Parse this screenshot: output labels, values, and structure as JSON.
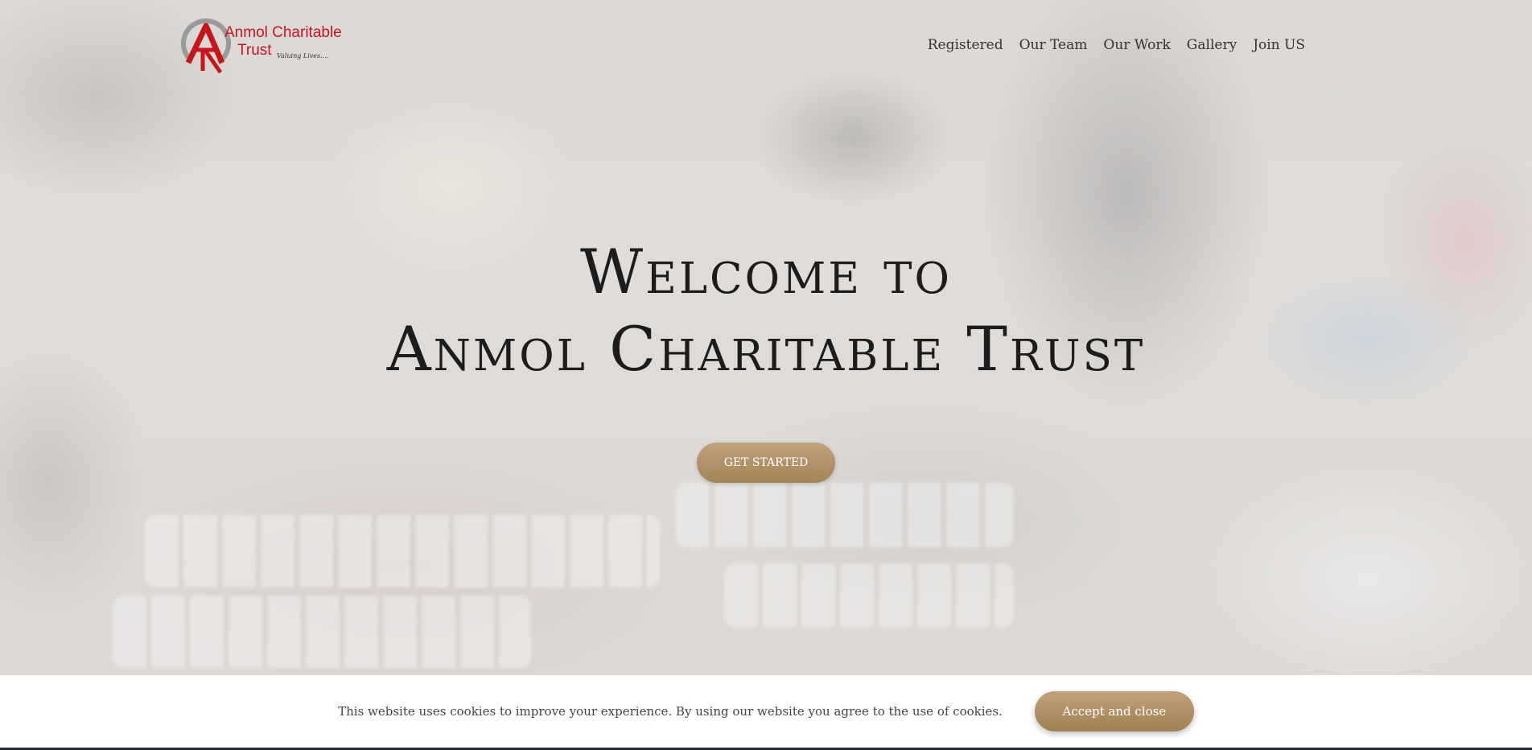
{
  "brand": {
    "name_line1": "Anmol Charitable",
    "name_line2": "Trust",
    "tagline": "Valuing Lives....",
    "color": "#c4161c"
  },
  "nav": {
    "items": [
      "Registered",
      "Our Team",
      "Our Work",
      "Gallery",
      "Join US"
    ]
  },
  "hero": {
    "title_line1": "Welcome to",
    "title_line2": "Anmol Charitable Trust",
    "cta_label": "GET STARTED",
    "accent_color": "#b08f64"
  },
  "cookie": {
    "message": "This website uses cookies to improve your experience. By using our website you agree to the use of cookies.",
    "accept_label": "Accept and close"
  }
}
